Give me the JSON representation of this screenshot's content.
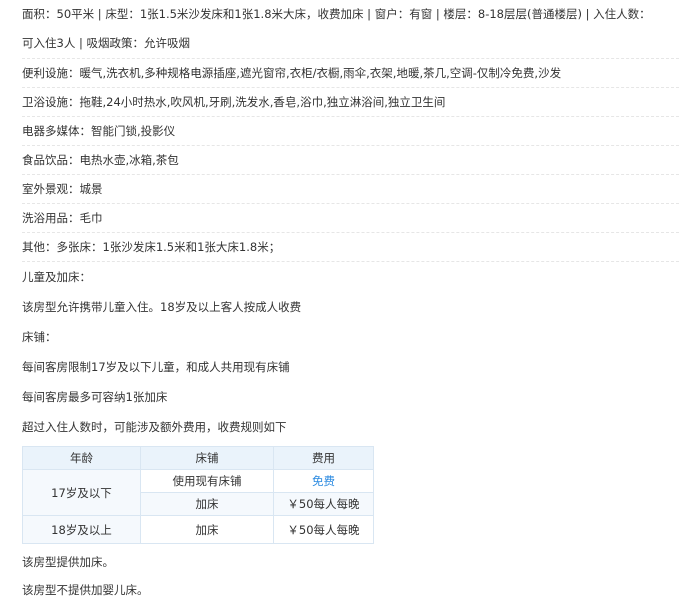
{
  "basic": {
    "line1": "面积：50平米 | 床型：1张1.5米沙发床和1张1.8米大床，收费加床 | 窗户：有窗 | 楼层：8-18层层(普通楼层) | 入住人数：",
    "line2": "可入住3人 | 吸烟政策：允许吸烟"
  },
  "facilities": [
    {
      "label": "便利设施：",
      "value": "暖气,洗衣机,多种规格电源插座,遮光窗帘,衣柜/衣橱,雨伞,衣架,地暖,茶几,空调-仅制冷免费,沙发"
    },
    {
      "label": "卫浴设施：",
      "value": "拖鞋,24小时热水,吹风机,牙刷,洗发水,香皂,浴巾,独立淋浴间,独立卫生间"
    },
    {
      "label": "电器多媒体：",
      "value": "智能门锁,投影仪"
    },
    {
      "label": "食品饮品：",
      "value": "电热水壶,冰箱,茶包"
    },
    {
      "label": "室外景观：",
      "value": "城景"
    },
    {
      "label": "洗浴用品：",
      "value": "毛巾"
    },
    {
      "label": "其他：",
      "value": "多张床：1张沙发床1.5米和1张大床1.8米；"
    }
  ],
  "policy": {
    "children_title": "儿童及加床：",
    "children_text": "该房型允许携带儿童入住。18岁及以上客人按成人收费",
    "bed_title": "床铺：",
    "bed_line1": "每间客房限制17岁及以下儿童，和成人共用现有床铺",
    "bed_line2": "每间客房最多可容纳1张加床",
    "fee_intro": "超过入住人数时，可能涉及额外费用，收费规则如下",
    "table": {
      "headers": [
        "年龄",
        "床铺",
        "费用"
      ],
      "rows": [
        {
          "age": "17岁及以下",
          "bed": "使用现有床铺",
          "fee": "免费"
        },
        {
          "age": "",
          "bed": "加床",
          "fee": "￥50每人每晚"
        },
        {
          "age": "18岁及以上",
          "bed": "加床",
          "fee": "￥50每人每晚"
        }
      ]
    },
    "extra_bed_note": "该房型提供加床。",
    "crib_note": "该房型不提供加婴儿床。"
  },
  "colors": {
    "text": "#333333",
    "free_link": "#2b8ae0",
    "table_header_bg": "#eaf3fb",
    "table_border": "#d9e6f2",
    "divider": "#e6e6e6"
  }
}
